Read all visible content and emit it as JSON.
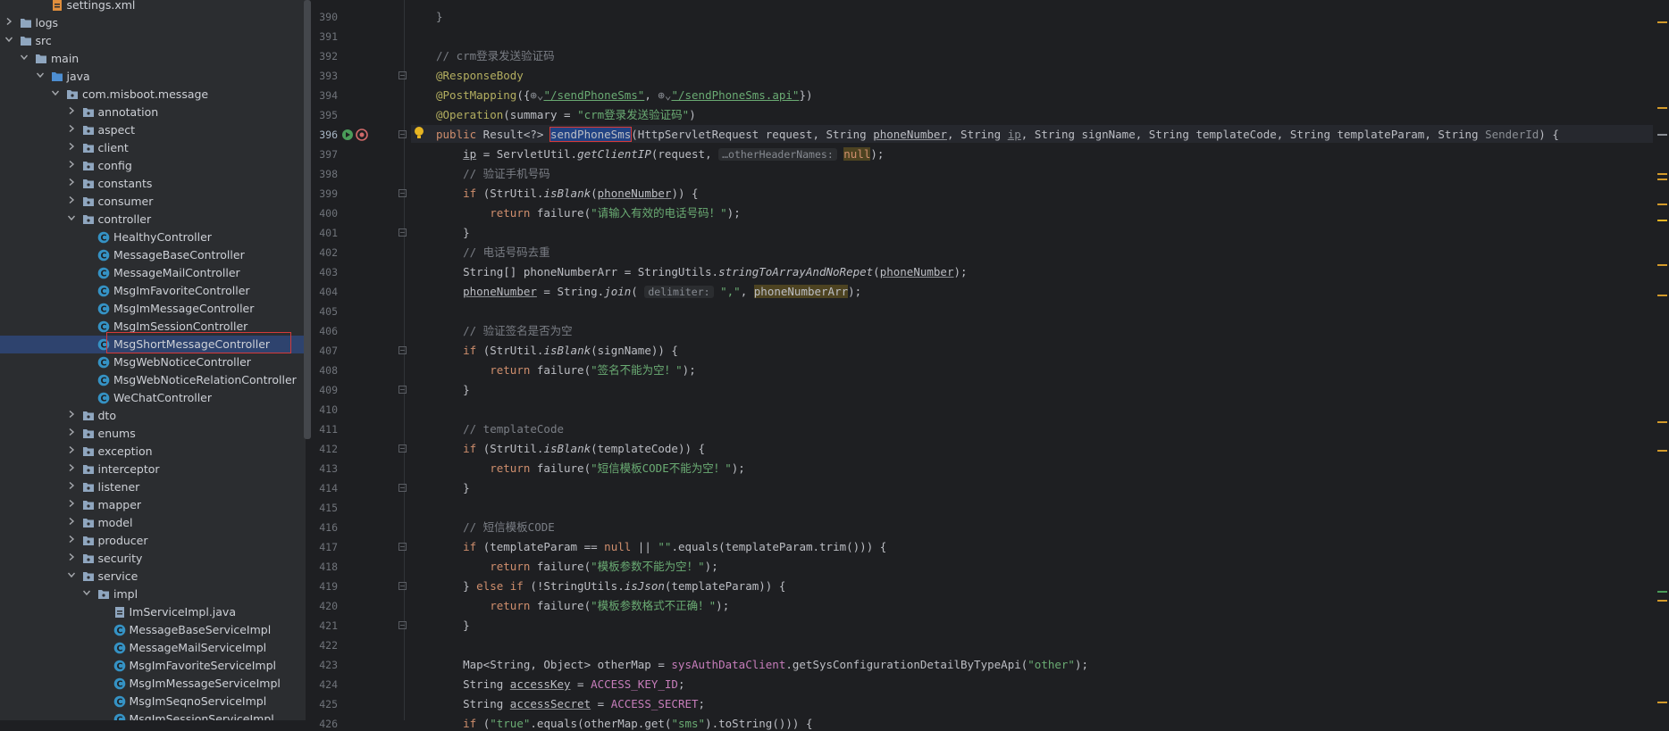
{
  "project_tree": {
    "items": [
      {
        "label": "settings.xml",
        "depth": 3,
        "type": "xml",
        "chev": "none"
      },
      {
        "label": "logs",
        "depth": 1,
        "type": "folder",
        "chev": "right"
      },
      {
        "label": "src",
        "depth": 1,
        "type": "folder",
        "chev": "down"
      },
      {
        "label": "main",
        "depth": 2,
        "type": "folder",
        "chev": "down"
      },
      {
        "label": "java",
        "depth": 3,
        "type": "src-folder",
        "chev": "down"
      },
      {
        "label": "com.misboot.message",
        "depth": 4,
        "type": "package",
        "chev": "down"
      },
      {
        "label": "annotation",
        "depth": 5,
        "type": "package",
        "chev": "right"
      },
      {
        "label": "aspect",
        "depth": 5,
        "type": "package",
        "chev": "right"
      },
      {
        "label": "client",
        "depth": 5,
        "type": "package",
        "chev": "right"
      },
      {
        "label": "config",
        "depth": 5,
        "type": "package",
        "chev": "right"
      },
      {
        "label": "constants",
        "depth": 5,
        "type": "package",
        "chev": "right"
      },
      {
        "label": "consumer",
        "depth": 5,
        "type": "package",
        "chev": "right"
      },
      {
        "label": "controller",
        "depth": 5,
        "type": "package",
        "chev": "down"
      },
      {
        "label": "HealthyController",
        "depth": 6,
        "type": "class",
        "chev": "none"
      },
      {
        "label": "MessageBaseController",
        "depth": 6,
        "type": "class",
        "chev": "none"
      },
      {
        "label": "MessageMailController",
        "depth": 6,
        "type": "class",
        "chev": "none"
      },
      {
        "label": "MsgImFavoriteController",
        "depth": 6,
        "type": "class",
        "chev": "none"
      },
      {
        "label": "MsgImMessageController",
        "depth": 6,
        "type": "class",
        "chev": "none"
      },
      {
        "label": "MsgImSessionController",
        "depth": 6,
        "type": "class",
        "chev": "none"
      },
      {
        "label": "MsgShortMessageController",
        "depth": 6,
        "type": "class",
        "chev": "none",
        "selected": true
      },
      {
        "label": "MsgWebNoticeController",
        "depth": 6,
        "type": "class",
        "chev": "none"
      },
      {
        "label": "MsgWebNoticeRelationController",
        "depth": 6,
        "type": "class",
        "chev": "none"
      },
      {
        "label": "WeChatController",
        "depth": 6,
        "type": "class",
        "chev": "none"
      },
      {
        "label": "dto",
        "depth": 5,
        "type": "package",
        "chev": "right"
      },
      {
        "label": "enums",
        "depth": 5,
        "type": "package",
        "chev": "right"
      },
      {
        "label": "exception",
        "depth": 5,
        "type": "package",
        "chev": "right"
      },
      {
        "label": "interceptor",
        "depth": 5,
        "type": "package",
        "chev": "right"
      },
      {
        "label": "listener",
        "depth": 5,
        "type": "package",
        "chev": "right"
      },
      {
        "label": "mapper",
        "depth": 5,
        "type": "package",
        "chev": "right"
      },
      {
        "label": "model",
        "depth": 5,
        "type": "package",
        "chev": "right"
      },
      {
        "label": "producer",
        "depth": 5,
        "type": "package",
        "chev": "right"
      },
      {
        "label": "security",
        "depth": 5,
        "type": "package",
        "chev": "right"
      },
      {
        "label": "service",
        "depth": 5,
        "type": "package",
        "chev": "down"
      },
      {
        "label": "impl",
        "depth": 6,
        "type": "package",
        "chev": "down"
      },
      {
        "label": "ImServiceImpl.java",
        "depth": 7,
        "type": "java-file",
        "chev": "none"
      },
      {
        "label": "MessageBaseServiceImpl",
        "depth": 7,
        "type": "class",
        "chev": "none"
      },
      {
        "label": "MessageMailServiceImpl",
        "depth": 7,
        "type": "class",
        "chev": "none"
      },
      {
        "label": "MsgImFavoriteServiceImpl",
        "depth": 7,
        "type": "class",
        "chev": "none"
      },
      {
        "label": "MsgImMessageServiceImpl",
        "depth": 7,
        "type": "class",
        "chev": "none"
      },
      {
        "label": "MsgImSeqnoServiceImpl",
        "depth": 7,
        "type": "class",
        "chev": "none"
      },
      {
        "label": "MsgImSessionServiceImpl",
        "depth": 7,
        "type": "class",
        "chev": "none"
      }
    ]
  },
  "editor": {
    "current_line": "396",
    "lines": [
      {
        "n": "390",
        "html": "}",
        "dim": true
      },
      {
        "n": "391",
        "html": ""
      },
      {
        "n": "392",
        "html": "<span class='cmt'>// crm登录发送验证码</span>"
      },
      {
        "n": "393",
        "html": "<span class='ann'>@ResponseBody</span>"
      },
      {
        "n": "394",
        "html": "<span class='ann'>@PostMapping</span>({<span class='dim'>⊕⌄</span><span class='u-str'>\"/sendPhoneSms\"</span>, <span class='dim'>⊕⌄</span><span class='u-str'>\"/sendPhoneSms.api\"</span>})"
      },
      {
        "n": "395",
        "html": "<span class='ann'>@Operation</span>(summary = <span class='str'>\"crm登录发送验证码\"</span>)"
      },
      {
        "n": "396",
        "html": "<span class='kw'>public</span> Result&lt;?&gt; <span class='selword'>sendPhoneSms</span>(HttpServletRequest request, String <span class='ul'>phoneNumber</span>, String <span class='ul dim'>ip</span>, String signName, String templateCode, String templateParam, String <span class='dim'>SenderId</span>) {"
      },
      {
        "n": "397",
        "html": "    <span class='ul'>ip</span> = ServletUtil.<span class='fn'>getClientIP</span>(request, <span class='hint'>…otherHeaderNames:</span> <span class='kw warnbg'>null</span>);"
      },
      {
        "n": "398",
        "html": "    <span class='cmt'>// 验证手机号码</span>"
      },
      {
        "n": "399",
        "html": "    <span class='kw'>if</span> (StrUtil.<span class='fn'>isBlank</span>(<span class='ul'>phoneNumber</span>)) {"
      },
      {
        "n": "400",
        "html": "        <span class='kw'>return</span> failure(<span class='str'>\"请输入有效的电话号码！\"</span>);"
      },
      {
        "n": "401",
        "html": "    }"
      },
      {
        "n": "402",
        "html": "    <span class='cmt'>// 电话号码去重</span>"
      },
      {
        "n": "403",
        "html": "    String[] phoneNumberArr = StringUtils.<span class='fn'>stringToArrayAndNoRepet</span>(<span class='ul'>phoneNumber</span>);"
      },
      {
        "n": "404",
        "html": "    <span class='ul'>phoneNumber</span> = String.<span class='fn'>join</span>( <span class='hint'>delimiter:</span> <span class='str'>\",\"</span>, <span class='warnbg'>phoneNumberArr</span>);"
      },
      {
        "n": "405",
        "html": ""
      },
      {
        "n": "406",
        "html": "    <span class='cmt'>// 验证签名是否为空</span>"
      },
      {
        "n": "407",
        "html": "    <span class='kw'>if</span> (StrUtil.<span class='fn'>isBlank</span>(signName)) {"
      },
      {
        "n": "408",
        "html": "        <span class='kw'>return</span> failure(<span class='str'>\"签名不能为空！\"</span>);"
      },
      {
        "n": "409",
        "html": "    }"
      },
      {
        "n": "410",
        "html": ""
      },
      {
        "n": "411",
        "html": "    <span class='cmt'>// templateCode</span>"
      },
      {
        "n": "412",
        "html": "    <span class='kw'>if</span> (StrUtil.<span class='fn'>isBlank</span>(templateCode)) {"
      },
      {
        "n": "413",
        "html": "        <span class='kw'>return</span> failure(<span class='str'>\"短信模板CODE不能为空！\"</span>);"
      },
      {
        "n": "414",
        "html": "    }"
      },
      {
        "n": "415",
        "html": ""
      },
      {
        "n": "416",
        "html": "    <span class='cmt'>// 短信模板CODE</span>"
      },
      {
        "n": "417",
        "html": "    <span class='kw'>if</span> (templateParam == <span class='kw'>null</span> || <span class='str'>\"\"</span>.equals(templateParam.trim())) {"
      },
      {
        "n": "418",
        "html": "        <span class='kw'>return</span> failure(<span class='str'>\"模板参数不能为空！\"</span>);"
      },
      {
        "n": "419",
        "html": "    } <span class='kw'>else if</span> (!StringUtils.<span class='fn'>isJson</span>(templateParam)) {"
      },
      {
        "n": "420",
        "html": "        <span class='kw'>return</span> failure(<span class='str'>\"模板参数格式不正确！\"</span>);"
      },
      {
        "n": "421",
        "html": "    }"
      },
      {
        "n": "422",
        "html": ""
      },
      {
        "n": "423",
        "html": "    Map&lt;String, Object&gt; otherMap = <span class='fld'>sysAuthDataClient</span>.getSysConfigurationDetailByTypeApi(<span class='str'>\"other\"</span>);"
      },
      {
        "n": "424",
        "html": "    String <span class='ul'>accessKey</span> = <span class='fld'>ACCESS_KEY_ID</span>;"
      },
      {
        "n": "425",
        "html": "    String <span class='ul'>accessSecret</span> = <span class='fld'>ACCESS_SECRET</span>;"
      },
      {
        "n": "426",
        "html": "    <span class='kw'>if</span> (<span class='str'>\"true\"</span>.equals(otherMap.get(<span class='str'>\"sms\"</span>).toString())) {"
      }
    ]
  },
  "colors": {
    "accent_selection": "#2e436e",
    "highlight_border": "#d53a3a",
    "warning_marker": "#d39a2a"
  }
}
